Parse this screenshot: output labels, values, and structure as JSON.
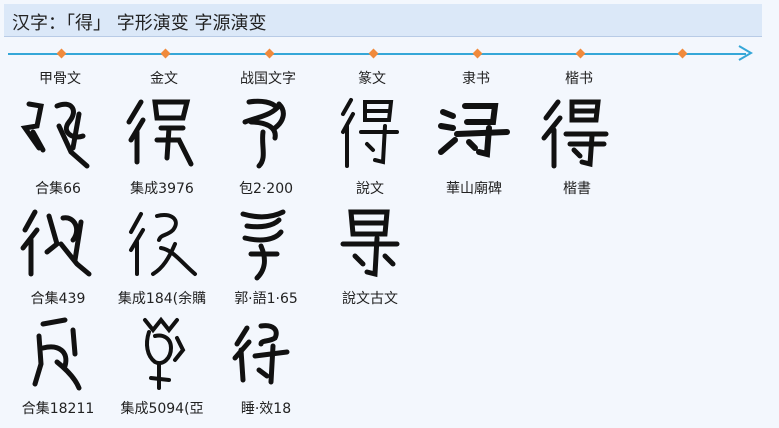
{
  "header": {
    "title": "汉字：「得」 字形演变 字源演变"
  },
  "eras": [
    "甲骨文",
    "金文",
    "战国文字",
    "篆文",
    "隶书",
    "楷书"
  ],
  "glyphs": [
    {
      "caption": "合集66",
      "icon": "oracle-bone-de-glyph"
    },
    {
      "caption": "集成3976",
      "icon": "bronze-de-glyph"
    },
    {
      "caption": "包2·200",
      "icon": "warring-states-de-glyph"
    },
    {
      "caption": "說文",
      "icon": "seal-de-glyph"
    },
    {
      "caption": "華山廟碑",
      "icon": "clerical-de-glyph"
    },
    {
      "caption": "楷書",
      "icon": "regular-de-glyph"
    },
    {
      "caption": "合集439",
      "icon": "oracle-bone-de-glyph"
    },
    {
      "caption": "集成184(余贎",
      "icon": "bronze-de-glyph"
    },
    {
      "caption": "郭·語1·65",
      "icon": "warring-states-de-glyph"
    },
    {
      "caption": "說文古文",
      "icon": "seal-ancient-de-glyph"
    },
    {
      "caption": "合集18211",
      "icon": "oracle-bone-de-glyph"
    },
    {
      "caption": "集成5094(亞",
      "icon": "bronze-de-glyph"
    },
    {
      "caption": "睡·效18",
      "icon": "qin-bamboo-de-glyph"
    }
  ],
  "colors": {
    "timeline": "#35a7d8",
    "marker": "#f08a3c",
    "header_bg": "#dbe8f8",
    "page_bg": "#f3f7fd"
  }
}
